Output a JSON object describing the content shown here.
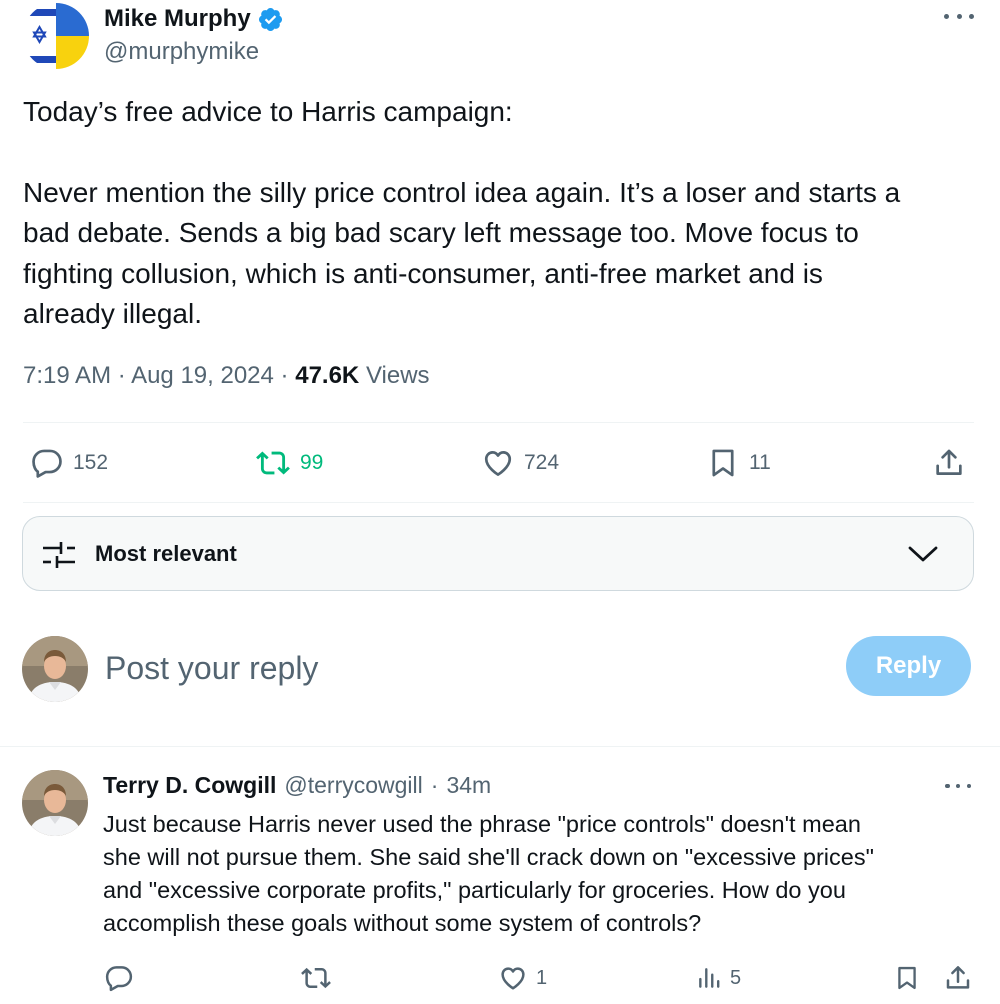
{
  "tweet": {
    "author_name": "Mike Murphy",
    "handle": "@murphymike",
    "text_lines": [
      "Today’s free advice to Harris campaign:",
      "Never mention the silly price control idea again. It’s a loser and starts a",
      "bad debate. Sends a big bad scary left message too.  Move focus to",
      "fighting collusion, which is anti-consumer, anti-free market and is",
      "already illegal."
    ],
    "time": "7:19 AM",
    "date": "Aug 19, 2024",
    "views_count": "47.6K",
    "views_label": "Views",
    "separator": "·"
  },
  "actions": {
    "replies": "152",
    "retweets": "99",
    "likes": "724",
    "bookmarks": "11"
  },
  "sort": {
    "label": "Most relevant"
  },
  "composer": {
    "placeholder": "Post your reply",
    "button_label": "Reply"
  },
  "reply": {
    "author_name": "Terry D. Cowgill",
    "handle": "@terrycowgill",
    "separator": "·",
    "age": "34m",
    "text_lines": [
      "Just because Harris never used the phrase \"price controls\" doesn't mean",
      "she will not pursue them. She said she'll crack down on \"excessive prices\"",
      "and \"excessive corporate profits,\" particularly for groceries. How do you",
      "accomplish these goals without some system of controls?"
    ],
    "likes": "1",
    "views": "5"
  },
  "colors": {
    "accent": "#1d9bf0",
    "retweet_green": "#00ba7c",
    "muted": "#536471",
    "reply_button": "#8ecdf8"
  },
  "icons": [
    "flag-avatar",
    "verified-badge-icon",
    "more-icon",
    "reply-icon",
    "retweet-icon",
    "like-icon",
    "bookmark-icon",
    "share-icon",
    "sort-sliders-icon",
    "chevron-down-icon",
    "views-icon"
  ]
}
